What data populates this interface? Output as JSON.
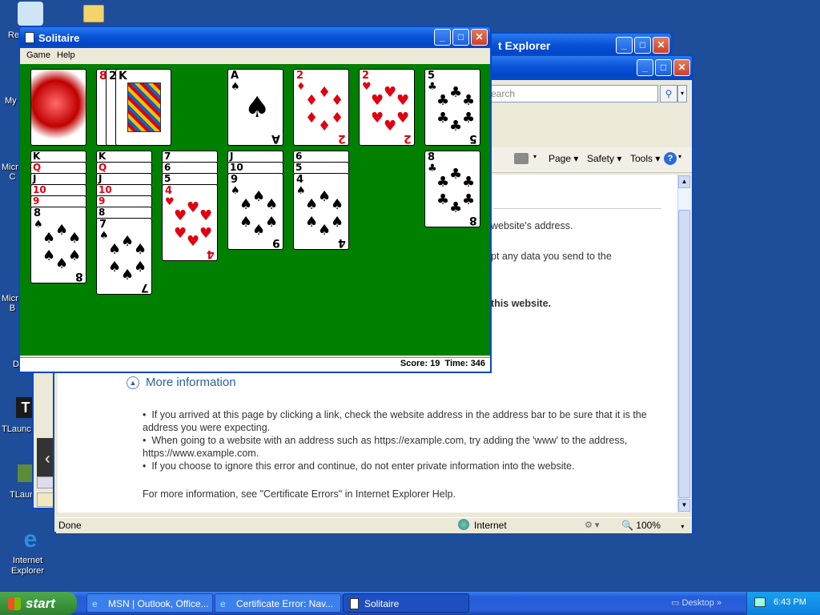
{
  "desktop": {
    "icons": [
      {
        "label": "Re"
      },
      {
        "label": "My"
      },
      {
        "label": "Micro\nC"
      },
      {
        "label": "Micro\nB"
      },
      {
        "label": "D"
      },
      {
        "label": "TLaunc"
      },
      {
        "label": "TLaun"
      },
      {
        "label": "Internet\nExplorer"
      }
    ]
  },
  "ie_back": {
    "title": "t Explorer"
  },
  "ie": {
    "search_placeholder": "earch",
    "toolbar": {
      "page": "Page",
      "safety": "Safety",
      "tools": "Tools"
    },
    "content": {
      "line1": "website's address.",
      "line2": "pt any data you send to the",
      "line3": "this website.",
      "more_info": "More information",
      "bullet1": "If you arrived at this page by clicking a link, check the website address in the address bar to be sure that it is the address you were expecting.",
      "bullet2": "When going to a website with an address such as https://example.com, try adding the 'www' to the address, https://www.example.com.",
      "bullet3": "If you choose to ignore this error and continue, do not enter private information into the website.",
      "footer": "For more information, see \"Certificate Errors\" in Internet Explorer Help."
    },
    "status": {
      "left": "Done",
      "zone": "Internet",
      "zoom": "100%"
    }
  },
  "solitaire": {
    "title": "Solitaire",
    "menu": [
      "Game",
      "Help"
    ],
    "status": "Score: 19  Time: 346",
    "colors": {
      "felt": "#008000",
      "red": "#e00010"
    },
    "waste": [
      "8",
      "2",
      "K"
    ],
    "foundations": [
      {
        "rank": "A",
        "suit": "♠",
        "color": "black"
      },
      {
        "rank": "2",
        "suit": "♦",
        "color": "red"
      },
      {
        "rank": "2",
        "suit": "♥",
        "color": "red"
      },
      {
        "rank": "5",
        "suit": "♣",
        "color": "black"
      }
    ],
    "tableau": [
      {
        "stubs": [
          "K",
          "Q",
          "J",
          "10",
          "9"
        ],
        "top": {
          "rank": "8",
          "suit": "♠",
          "color": "black"
        }
      },
      {
        "stubs": [
          "K",
          "Q",
          "J",
          "10",
          "9",
          "8"
        ],
        "top": {
          "rank": "7",
          "suit": "♠",
          "color": "black"
        }
      },
      {
        "stubs": [
          "7",
          "6",
          "5"
        ],
        "top": {
          "rank": "4",
          "suit": "♥",
          "color": "red"
        }
      },
      {
        "stubs": [
          "J",
          "10"
        ],
        "top": {
          "rank": "9",
          "suit": "♠",
          "color": "black"
        }
      },
      {
        "stubs": [
          "6",
          "5"
        ],
        "top": {
          "rank": "4",
          "suit": "♠",
          "color": "black"
        }
      },
      {
        "stubs": [],
        "top": null
      },
      {
        "stubs": [],
        "top": {
          "rank": "8",
          "suit": "♣",
          "color": "black"
        }
      }
    ]
  },
  "taskbar": {
    "start": "start",
    "tasks": [
      "MSN | Outlook, Office...",
      "Certificate Error: Nav...",
      "Solitaire"
    ],
    "desktop_label": "Desktop",
    "clock": "6:43 PM"
  }
}
